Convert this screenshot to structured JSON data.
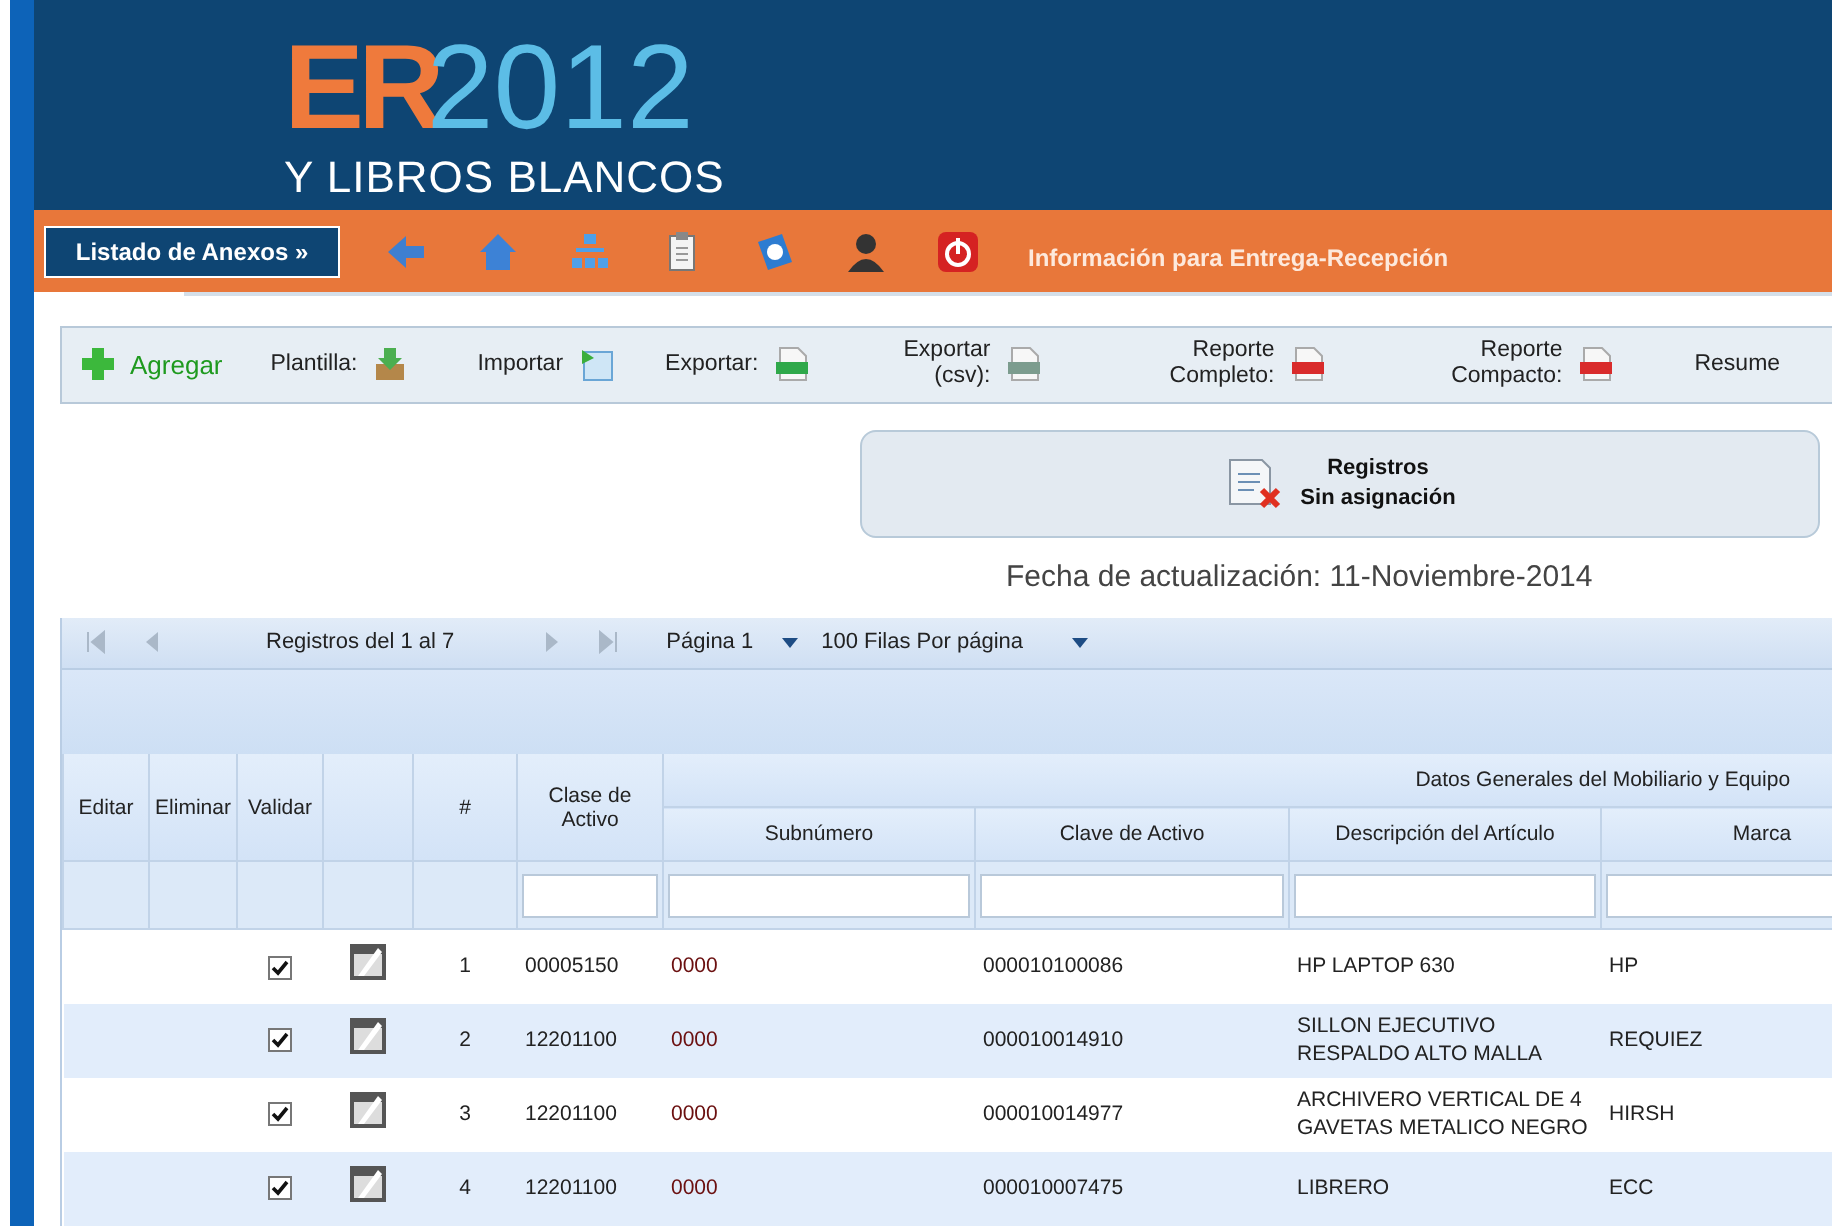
{
  "header": {
    "logo_main": "ER",
    "logo_year": "2012",
    "logo_subtitle": "Y LIBROS BLANCOS"
  },
  "nav": {
    "menu_button": "Listado de Anexos »",
    "title": "Información para Entrega-Recepción"
  },
  "toolbar": [
    {
      "kind": "add",
      "label": "Agregar"
    },
    {
      "kind": "template",
      "label": "Plantilla:"
    },
    {
      "kind": "import",
      "label": "Importar"
    },
    {
      "kind": "xls",
      "label": "Exportar:"
    },
    {
      "kind": "csv",
      "label": "Exportar (csv):"
    },
    {
      "kind": "pdf",
      "label": "Reporte Completo:"
    },
    {
      "kind": "pdf",
      "label": "Reporte Compacto:"
    },
    {
      "kind": "plain",
      "label": "Resume"
    }
  ],
  "unassigned_button": {
    "line_1": "Registros",
    "line_2": "Sin asignación"
  },
  "update_date": "Fecha de actualización: 11-Noviembre-2014",
  "pager": {
    "records": "Registros del 1 al 7",
    "page": "Página 1",
    "rows_per_page": "100 Filas Por página"
  },
  "table": {
    "columns": [
      {
        "kind": "text",
        "label": "Editar"
      },
      {
        "kind": "text",
        "label": "Eliminar"
      },
      {
        "kind": "text",
        "label": "Validar"
      },
      {
        "kind": "blank"
      },
      {
        "kind": "text",
        "label": "#"
      },
      {
        "kind": "filter",
        "label": "Clase de Activo"
      }
    ],
    "group": {
      "label": "Datos Generales del Mobiliario y Equipo",
      "columns": [
        "Subnúmero",
        "Clave de Activo",
        "Descripción del Artículo",
        "Marca"
      ]
    },
    "rows": [
      {
        "validated": true,
        "number": "1",
        "clase": "00005150",
        "subnumero": "0000",
        "clave": "000010100086",
        "descripcion": "HP LAPTOP 630",
        "marca": "HP"
      },
      {
        "validated": true,
        "number": "2",
        "clase": "12201100",
        "subnumero": "0000",
        "clave": "000010014910",
        "descripcion": "SILLON EJECUTIVO RESPALDO ALTO MALLA",
        "marca": "REQUIEZ"
      },
      {
        "validated": true,
        "number": "3",
        "clase": "12201100",
        "subnumero": "0000",
        "clave": "000010014977",
        "descripcion": "ARCHIVERO VERTICAL DE 4 GAVETAS METALICO NEGRO",
        "marca": "HIRSH"
      },
      {
        "validated": true,
        "number": "4",
        "clase": "12201100",
        "subnumero": "0000",
        "clave": "000010007475",
        "descripcion": "LIBRERO",
        "marca": "ECC"
      }
    ]
  }
}
